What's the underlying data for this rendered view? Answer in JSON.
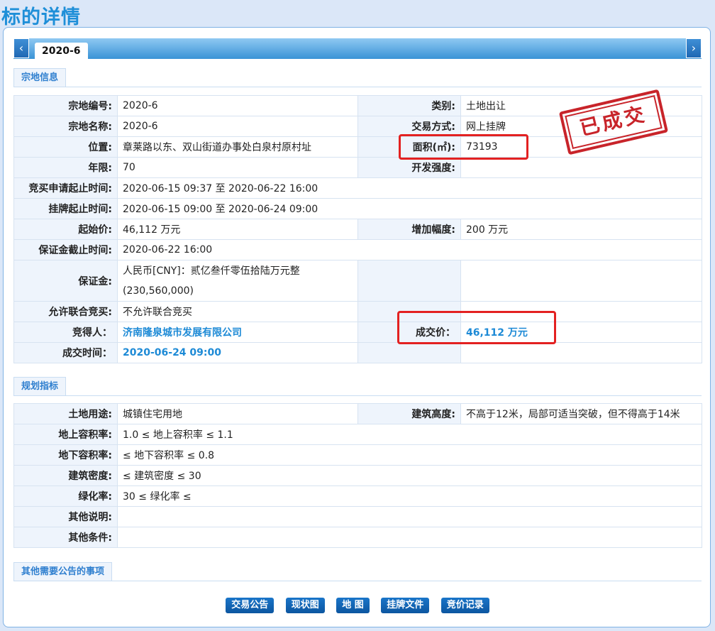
{
  "page_title": "标的详情",
  "tab": {
    "active": "2020-6",
    "prev_icon": "‹",
    "next_icon": "›"
  },
  "sections": {
    "land_info": "宗地信息",
    "planning": "规划指标",
    "other": "其他需要公告的事项"
  },
  "stamp": "已成交",
  "land": {
    "parcel_no_label": "宗地编号:",
    "parcel_no": "2020-6",
    "category_label": "类别:",
    "category": "土地出让",
    "parcel_name_label": "宗地名称:",
    "parcel_name": "2020-6",
    "trade_method_label": "交易方式:",
    "trade_method": "网上挂牌",
    "location_label": "位置:",
    "location": "章莱路以东、双山街道办事处白泉村原村址",
    "area_label": "面积(㎡):",
    "area": "73193",
    "term_label": "年限:",
    "term": "70",
    "intensity_label": "开发强度:",
    "intensity": "",
    "bid_apply_label": "竞买申请起止时间:",
    "bid_apply": "2020-06-15 09:37 至 2020-06-22 16:00",
    "listing_label": "挂牌起止时间:",
    "listing": "2020-06-15 09:00 至 2020-06-24 09:00",
    "start_price_label": "起始价:",
    "start_price": "46,112 万元",
    "increment_label": "增加幅度:",
    "increment": "200 万元",
    "deposit_deadline_label": "保证金截止时间:",
    "deposit_deadline": "2020-06-22 16:00",
    "deposit_label": "保证金:",
    "deposit_line1": "人民币[CNY]：贰亿叁仟零伍拾陆万元整",
    "deposit_line2": "(230,560,000)",
    "joint_label": "允许联合竞买:",
    "joint": "不允许联合竞买",
    "winner_label": "竞得人：",
    "winner": "济南隆泉城市发展有限公司",
    "deal_price_label": "成交价：",
    "deal_price": "46,112 万元",
    "deal_time_label": "成交时间：",
    "deal_time": "2020-06-24 09:00"
  },
  "planning": {
    "land_use_label": "土地用途:",
    "land_use": "城镇住宅用地",
    "height_label": "建筑高度:",
    "height": "不高于12米，局部可适当突破，但不得高于14米",
    "far_above_label": "地上容积率:",
    "far_above": "1.0 ≤ 地上容积率 ≤ 1.1",
    "far_below_label": "地下容积率:",
    "far_below": "≤ 地下容积率 ≤ 0.8",
    "density_label": "建筑密度:",
    "density": "≤ 建筑密度 ≤ 30",
    "green_label": "绿化率:",
    "green": "30 ≤ 绿化率 ≤",
    "other_desc_label": "其他说明:",
    "other_desc": "",
    "other_cond_label": "其他条件:",
    "other_cond": ""
  },
  "buttons": [
    "交易公告",
    "现状图",
    "地 图",
    "挂牌文件",
    "竞价记录"
  ],
  "colors": {
    "accent": "#1f8fd8",
    "highlight": "#e32121",
    "stamp": "#c8242a"
  }
}
